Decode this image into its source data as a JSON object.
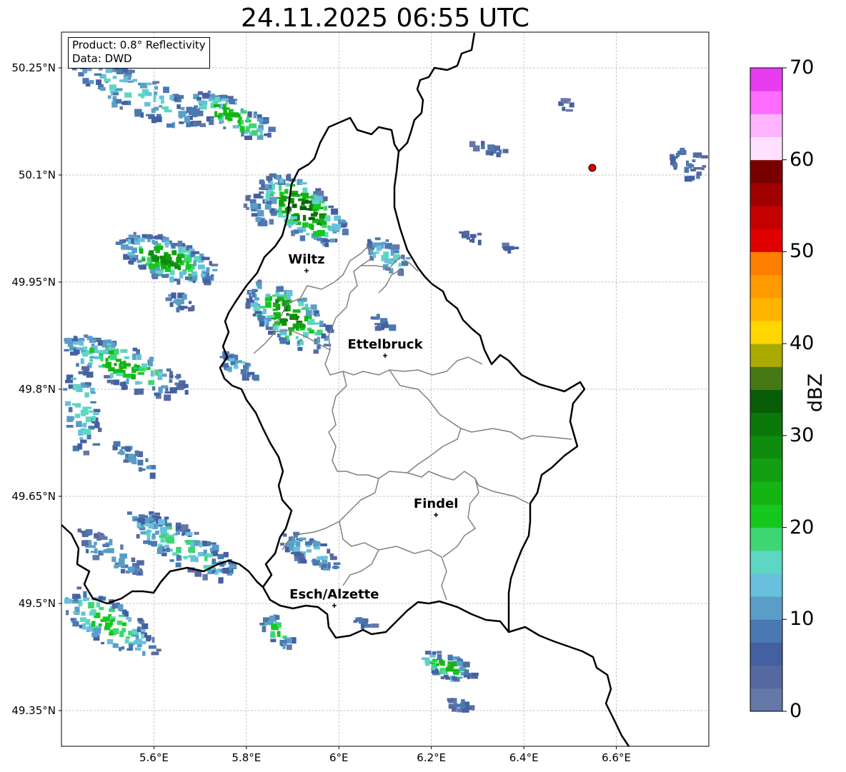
{
  "title": "24.11.2025 06:55 UTC",
  "info": {
    "product": "Product: 0.8° Reflectivity",
    "data": "Data: DWD"
  },
  "map": {
    "lon_range": [
      5.4,
      6.8
    ],
    "lat_range": [
      49.3,
      50.3
    ],
    "lon_ticks": [
      5.6,
      5.8,
      6.0,
      6.2,
      6.4,
      6.6
    ],
    "lon_tick_labels": [
      "5.6°E",
      "5.8°E",
      "6°E",
      "6.2°E",
      "6.4°E",
      "6.6°E"
    ],
    "lat_ticks": [
      50.25,
      50.1,
      49.95,
      49.8,
      49.65,
      49.5,
      49.35
    ],
    "lat_tick_labels": [
      "50.25°N",
      "50.1°N",
      "49.95°N",
      "49.8°N",
      "49.65°N",
      "49.5°N",
      "49.35°N"
    ],
    "gridlines": true,
    "cities": [
      {
        "name": "Wiltz",
        "lon": 5.93,
        "lat": 49.966
      },
      {
        "name": "Ettelbruck",
        "lon": 6.1,
        "lat": 49.847
      },
      {
        "name": "Findel",
        "lon": 6.21,
        "lat": 49.624
      },
      {
        "name": "Esch/Alzette",
        "lon": 5.99,
        "lat": 49.497
      }
    ],
    "radar_site": {
      "lon": 6.548,
      "lat": 50.11,
      "color": "#e00000"
    }
  },
  "colorbar": {
    "label": "dBZ",
    "min": 0,
    "max": 70,
    "tick_values": [
      0,
      10,
      20,
      30,
      40,
      50,
      60,
      70
    ],
    "tick_labels": [
      "0",
      "10",
      "20",
      "30",
      "40",
      "50",
      "60",
      "70"
    ],
    "colors": [
      "#6678a8",
      "#5568a0",
      "#4460a2",
      "#4a78b0",
      "#5a9ec8",
      "#68c0dc",
      "#5ed6c4",
      "#3ed672",
      "#14c81e",
      "#14b414",
      "#12a012",
      "#0e8c0e",
      "#0b780b",
      "#075e07",
      "#467814",
      "#aaaa00",
      "#ffd600",
      "#ffb400",
      "#ff9a00",
      "#ff7e00",
      "#e00000",
      "#c40000",
      "#a00000",
      "#7a0000",
      "#ffe0ff",
      "#ffb4ff",
      "#ff6cff",
      "#e83cf0"
    ]
  }
}
